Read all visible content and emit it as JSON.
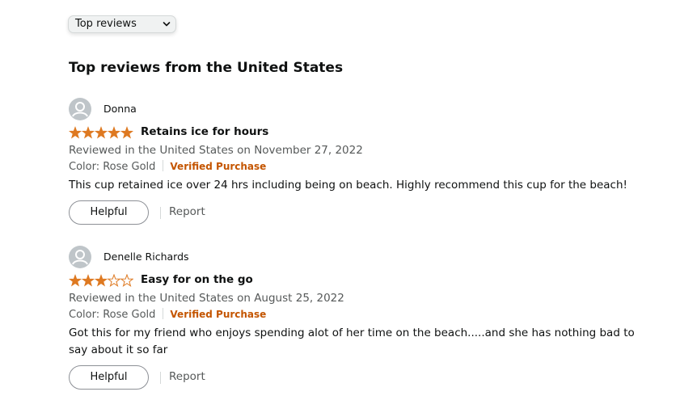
{
  "sort": {
    "selected": "Top reviews"
  },
  "section_title": "Top reviews from the United States",
  "colors": {
    "star": "#de7921",
    "verified": "#c45500",
    "avatar_bg": "#bfc5c9"
  },
  "reviews": [
    {
      "author": "Donna",
      "rating": 5,
      "max_rating": 5,
      "title": "Retains ice for hours",
      "date_line": "Reviewed in the United States on November 27, 2022",
      "color_label": "Color: Rose Gold",
      "verified_label": "Verified Purchase",
      "body": "This cup retained ice over 24 hrs including being on beach. Highly recommend this cup for the beach!",
      "helpful_label": "Helpful",
      "report_label": "Report"
    },
    {
      "author": "Denelle Richards",
      "rating": 3,
      "max_rating": 5,
      "title": "Easy for on the go",
      "date_line": "Reviewed in the United States on August 25, 2022",
      "color_label": "Color: Rose Gold",
      "verified_label": "Verified Purchase",
      "body": "Got this for my friend who enjoys spending alot of her time on the beach.....and she has nothing bad to say about it so far",
      "helpful_label": "Helpful",
      "report_label": "Report"
    }
  ]
}
